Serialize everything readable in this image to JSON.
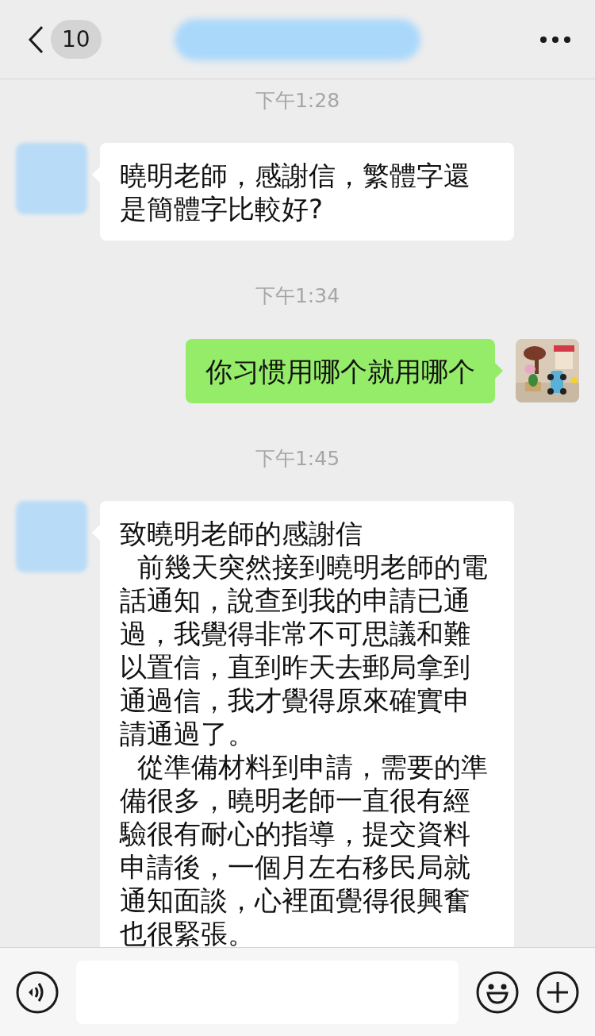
{
  "nav_bar": {
    "unread_count": "10"
  },
  "messages": [
    {
      "kind": "time",
      "text": "下午1:28"
    },
    {
      "kind": "incoming",
      "paragraphs": [
        "曉明老師，感謝信，繁體字還是簡體字比較好?"
      ]
    },
    {
      "kind": "time",
      "text": "下午1:34"
    },
    {
      "kind": "outgoing",
      "paragraphs": [
        "你习惯用哪个就用哪个"
      ]
    },
    {
      "kind": "time",
      "text": "下午1:45"
    },
    {
      "kind": "incoming",
      "paragraphs": [
        "致曉明老師的感謝信",
        "  前幾天突然接到曉明老師的電話通知，說查到我的申請已通過，我覺得非常不可思議和難以置信，直到昨天去郵局拿到通過信，我才覺得原來確實申請通過了。",
        "  從準備材料到申請，需要的準備很多，曉明老師一直很有經驗很有耐心的指導，提交資料申請後，一個月左右移民局就通知面談，心裡面覺得很興奮也很緊張。"
      ]
    }
  ]
}
